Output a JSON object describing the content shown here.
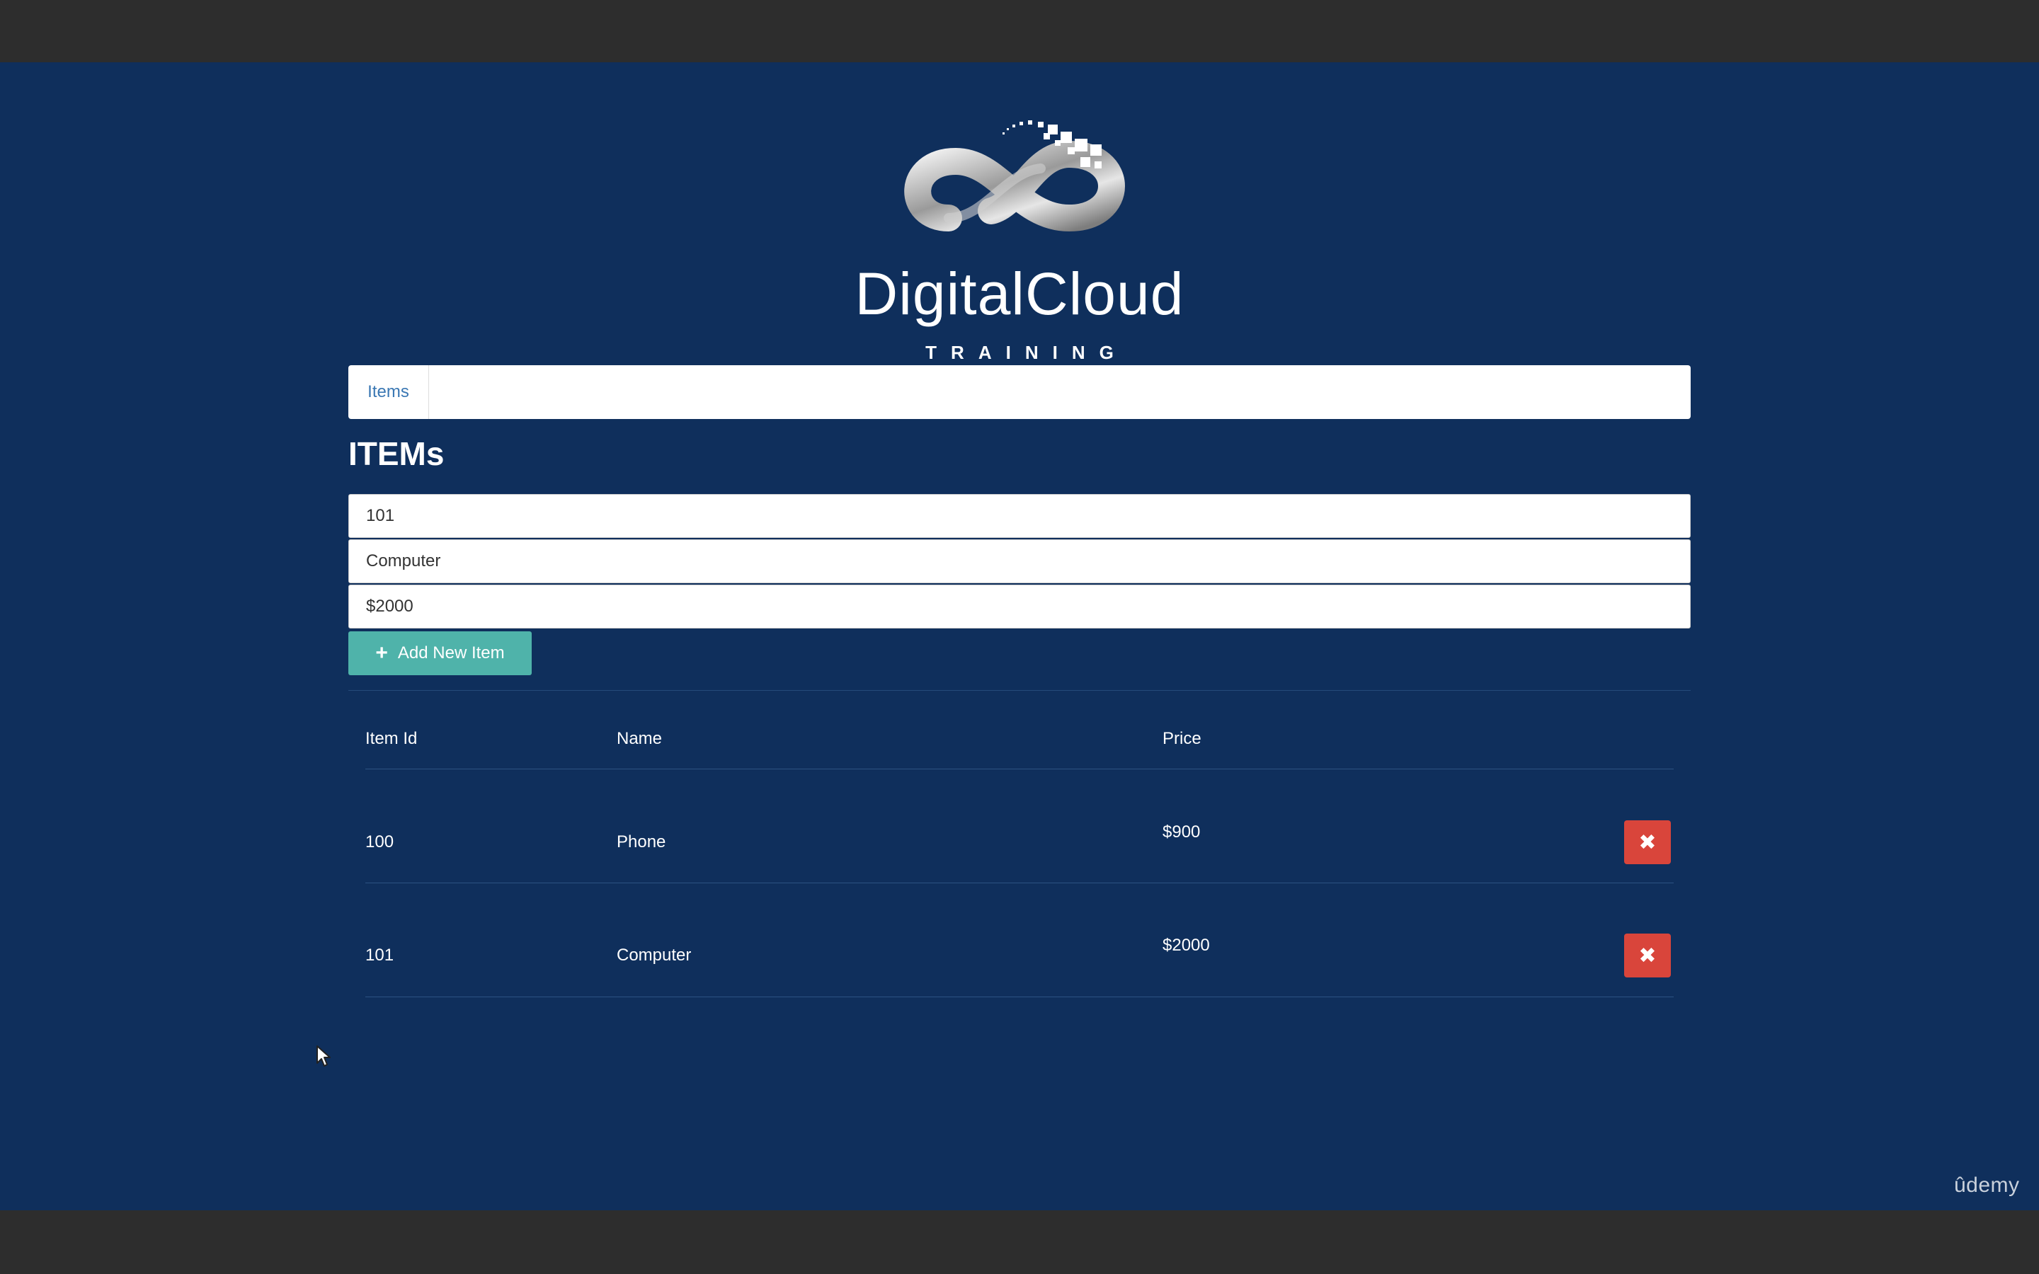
{
  "logo": {
    "wordmark": "DigitalCloud",
    "subtitle": "TRAINING"
  },
  "nav": {
    "tabs": [
      {
        "label": "Items"
      }
    ]
  },
  "page": {
    "title": "ITEMs"
  },
  "form": {
    "item_id_value": "101",
    "name_value": "Computer",
    "price_value": "$2000",
    "add_button_label": "Add New Item"
  },
  "table": {
    "headers": [
      "Item Id",
      "Name",
      "Price"
    ],
    "rows": [
      {
        "id": "100",
        "name": "Phone",
        "price": "$900"
      },
      {
        "id": "101",
        "name": "Computer",
        "price": "$2000"
      }
    ]
  },
  "icons": {
    "add": "plus-icon",
    "delete": "close-icon",
    "pointer": "cursor-icon"
  },
  "colors": {
    "background": "#0f2f5c",
    "add_button": "#4fb3aa",
    "delete_button": "#d9453b",
    "nav_link": "#3a77b3"
  },
  "watermark": "ûdemy"
}
